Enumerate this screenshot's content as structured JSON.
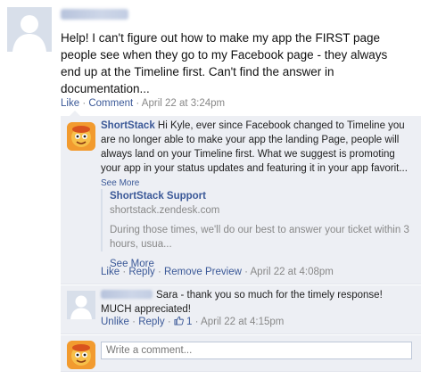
{
  "post": {
    "text": "Help! I can't figure out how to make my app the FIRST page people see when they go to my Facebook page - they always end up at the Timeline first. Can't find the answer in documentation...",
    "actions": {
      "like": "Like",
      "comment": "Comment"
    },
    "timestamp": "April 22 at 3:24pm"
  },
  "comments": {
    "first": {
      "author": "ShortStack",
      "text": "Hi Kyle, ever since Facebook changed to Timeline you are no longer able to make your app the landing Page, people will always land on your Timeline first. What we suggest is promoting your app in your status updates and featuring it in your app favorit...",
      "see_more": "See More",
      "attachment": {
        "title": "ShortStack Support",
        "domain": "shortstack.zendesk.com",
        "description": "During those times, we'll do our best to answer your ticket within 3 hours, usua...",
        "see_more": "See More"
      },
      "actions": {
        "like": "Like",
        "reply": "Reply",
        "remove_preview": "Remove Preview"
      },
      "timestamp": "April 22 at 4:08pm"
    },
    "second": {
      "text": "Sara - thank you so much for the timely response! MUCH appreciated!",
      "actions": {
        "unlike": "Unlike",
        "reply": "Reply"
      },
      "like_count": "1",
      "timestamp": "April 22 at 4:15pm"
    },
    "composer": {
      "placeholder": "Write a comment..."
    }
  },
  "colors": {
    "link": "#3b5998",
    "comment_bg": "#edeff4",
    "meta": "#888888"
  }
}
